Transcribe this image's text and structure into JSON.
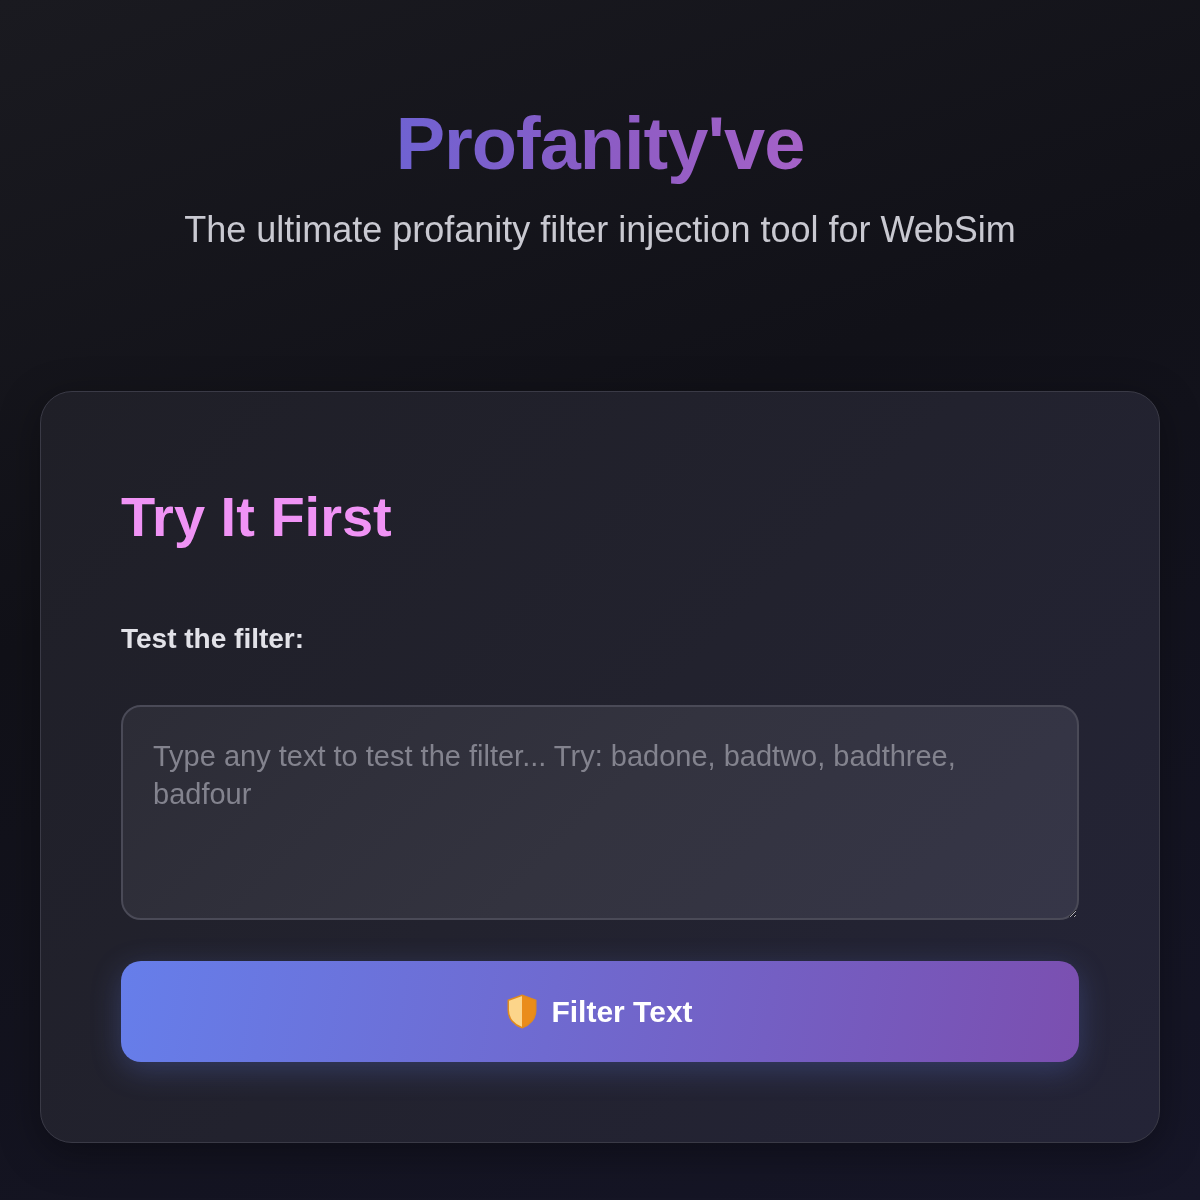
{
  "header": {
    "title": "Profanity've",
    "subtitle": "The ultimate profanity filter injection tool for WebSim"
  },
  "card": {
    "heading": "Try It First",
    "field": {
      "label": "Test the filter:",
      "placeholder": "Type any text to test the filter... Try: badone, badtwo, badthree, badfour"
    },
    "button": {
      "label": "Filter Text"
    }
  }
}
